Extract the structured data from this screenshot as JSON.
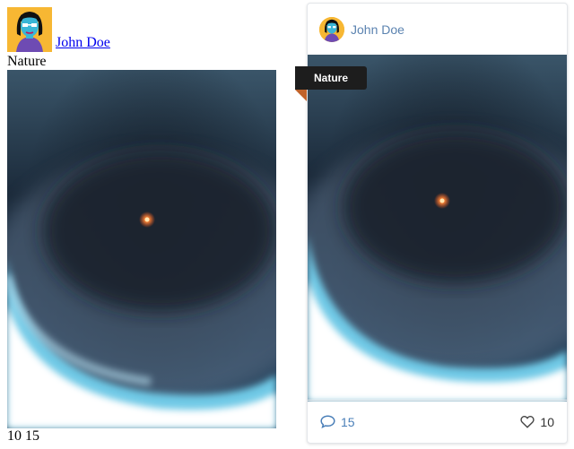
{
  "post": {
    "author_name": "John Doe",
    "category": "Nature",
    "comment_count": "15",
    "like_count": "10",
    "raw_counts": "10 15"
  },
  "icons": {
    "comment": "speech-bubble-icon",
    "like": "heart-icon"
  },
  "colors": {
    "link": "#0000ee",
    "card_author": "#5b83b0",
    "comment_accent": "#4a7fb8",
    "tag_bg": "#1d1d1d",
    "tag_fold": "#c0622a",
    "avatar_bg": "#f7b733"
  }
}
